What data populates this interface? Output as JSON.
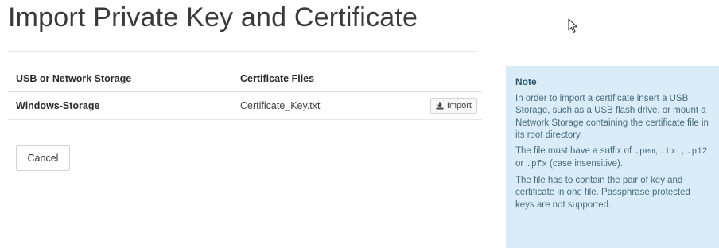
{
  "page": {
    "title": "Import Private Key and Certificate"
  },
  "table": {
    "headers": {
      "storage": "USB or Network Storage",
      "files": "Certificate Files"
    },
    "rows": [
      {
        "storage": "Windows-Storage",
        "file": "Certificate_Key.txt",
        "action_label": "Import",
        "action_icon": "import-icon"
      }
    ]
  },
  "actions": {
    "cancel_label": "Cancel"
  },
  "note": {
    "title": "Note",
    "para1": "In order to import a certificate insert a USB Storage, such as a USB flash drive, or mount a Network Storage containing the certificate file in its root directory.",
    "para2_prefix": "The file must have a suffix of ",
    "suffix_pem": ".pem",
    "sep1": ", ",
    "suffix_txt": ".txt",
    "sep2": ", ",
    "suffix_p12": ".p12",
    "sep3": " or ",
    "suffix_pfx": ".pfx",
    "para2_suffix": " (case insensitive).",
    "para3": "The file has to contain the pair of key and certificate in one file. Passphrase protected keys are not supported."
  },
  "colors": {
    "note_background": "#d9ecf7",
    "note_text": "#4a6b80",
    "title_text": "#3a3a3a"
  }
}
